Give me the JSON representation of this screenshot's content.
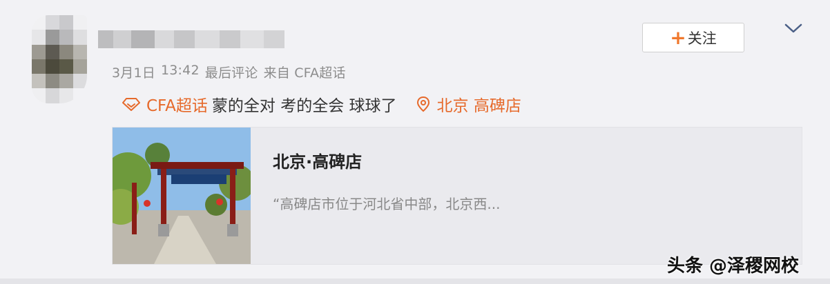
{
  "post": {
    "meta": {
      "date": "3月1日",
      "time": "13:42",
      "action": "最后评论",
      "source": "来自 CFA超话"
    },
    "topic_label": "CFA超话",
    "text": "蒙的全对 考的全会 球球了",
    "location": "北京 高碑店"
  },
  "header": {
    "follow_plus": "+",
    "follow_label": "关注"
  },
  "place_card": {
    "title": "北京·高碑店",
    "description": "“高碑店市位于河北省中部，北京西..."
  },
  "watermark": "头条 @泽稷网校",
  "colors": {
    "accent": "#e6692a",
    "text": "#333333",
    "meta": "#8c8c8c",
    "background": "#f2f2f5"
  },
  "icons": {
    "topic": "diamond-icon",
    "location": "location-pin-icon",
    "expand": "chevron-down-icon"
  }
}
